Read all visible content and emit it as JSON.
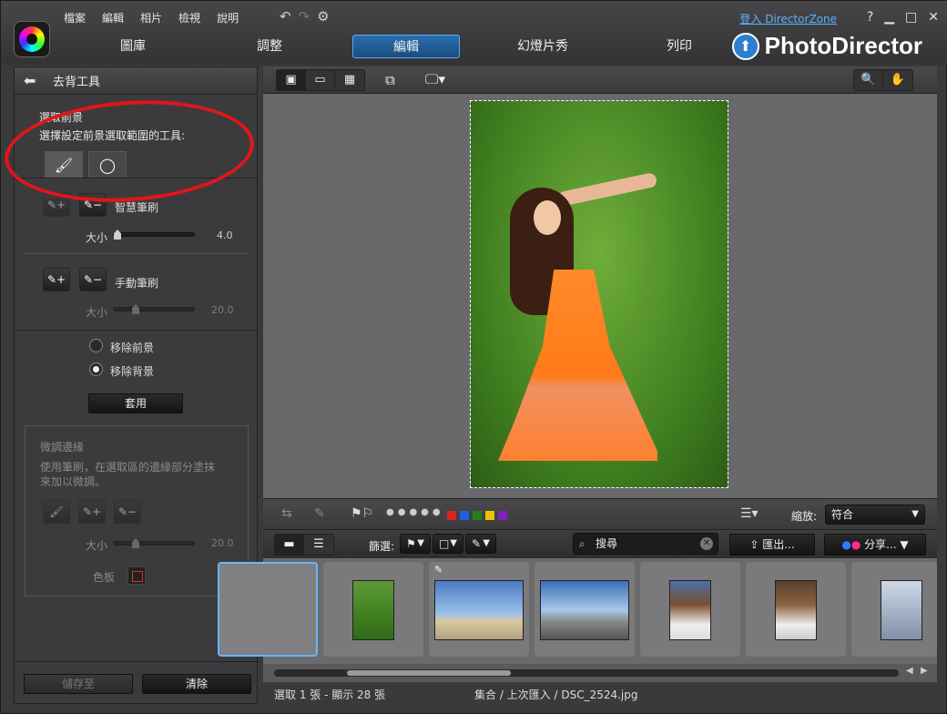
{
  "menu": [
    "檔案",
    "編輯",
    "相片",
    "檢視",
    "說明"
  ],
  "login": "登入 DirectorZone",
  "tabs": [
    "圖庫",
    "調整",
    "編輯",
    "幻燈片秀",
    "列印"
  ],
  "brand": "PhotoDirector",
  "panel": {
    "title": "去背工具",
    "section_title": "選取前景",
    "section_desc": "選擇設定前景選取範圍的工具:",
    "smart_brush_label": "智慧筆刷",
    "size_label": "大小",
    "smart_size_value": 4.0,
    "smart_size_text": "4.0",
    "manual_brush_label": "手動筆刷",
    "manual_size_value": 20.0,
    "manual_size_text": "20.0",
    "remove_fg": "移除前景",
    "remove_bg": "移除背景",
    "remove_bg_checked": true,
    "apply": "套用",
    "fine_title": "微調邊緣",
    "fine_desc1": "使用筆刷，在選取區的邊緣部分塗抹",
    "fine_desc2": "來加以微調。",
    "fine_size_text": "20.0",
    "color_label": "色板",
    "save_as": "儲存至",
    "clear": "清除"
  },
  "viewer": {
    "zoom_label": "縮放:",
    "zoom_value": "符合",
    "colors": [
      "#e02020",
      "#2060e0",
      "#208020",
      "#f0c000",
      "#8020c0"
    ]
  },
  "browser": {
    "filter_label": "篩選:",
    "search_placeholder": "搜尋",
    "export": "匯出...",
    "share": "分享..."
  },
  "status": {
    "left": "選取 1 張 - 顯示 28 張",
    "center": "集合 / 上次匯入 / DSC_2524.jpg"
  }
}
